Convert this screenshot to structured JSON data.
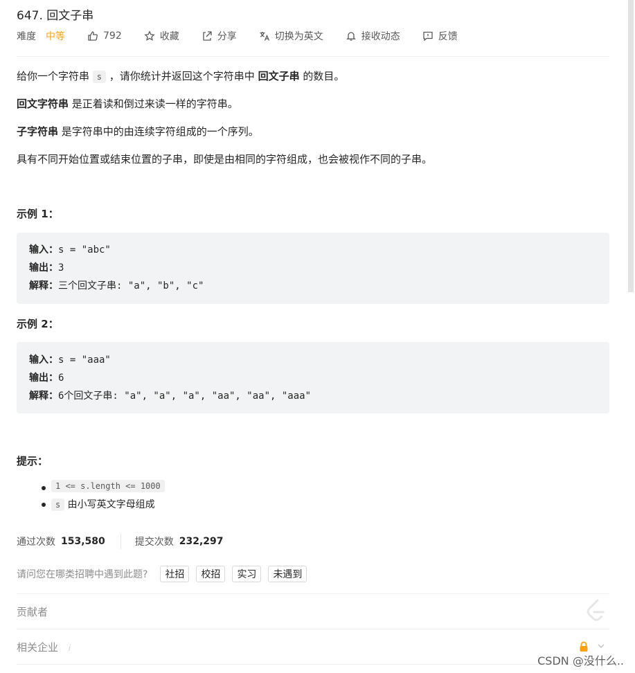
{
  "header": {
    "title": "647. 回文子串",
    "difficulty_label": "难度",
    "difficulty_value": "中等",
    "likes": "792",
    "favorite": "收藏",
    "share": "分享",
    "translate": "切换为英文",
    "notify": "接收动态",
    "feedback": "反馈"
  },
  "colors": {
    "difficulty": "#ffa116",
    "code_bg": "#f2f3f4"
  },
  "description": {
    "p1_before": "给你一个字符串 ",
    "p1_code": "s",
    "p1_mid": " ，请你统计并返回这个字符串中 ",
    "p1_bold": "回文子串",
    "p1_after": " 的数目。",
    "p2_bold": "回文字符串",
    "p2_rest": " 是正着读和倒过来读一样的字符串。",
    "p3_bold": "子字符串",
    "p3_rest": " 是字符串中的由连续字符组成的一个序列。",
    "p4": "具有不同开始位置或结束位置的子串，即使是由相同的字符组成，也会被视作不同的子串。"
  },
  "examples": [
    {
      "title": "示例 1：",
      "input_label": "输入：",
      "input": "s = \"abc\"",
      "output_label": "输出：",
      "output": "3",
      "explain_label": "解释：",
      "explain": "三个回文子串: \"a\", \"b\", \"c\""
    },
    {
      "title": "示例 2：",
      "input_label": "输入：",
      "input": "s = \"aaa\"",
      "output_label": "输出：",
      "output": "6",
      "explain_label": "解释：",
      "explain": "6个回文子串: \"a\", \"a\", \"a\", \"aa\", \"aa\", \"aaa\""
    }
  ],
  "tips": {
    "title": "提示：",
    "items": [
      {
        "code": "1 <= s.length <= 1000",
        "text": ""
      },
      {
        "code": "s",
        "text": " 由小写英文字母组成"
      }
    ]
  },
  "stats": {
    "accepted_label": "通过次数",
    "accepted": "153,580",
    "submitted_label": "提交次数",
    "submitted": "232,297"
  },
  "interview": {
    "question": "请问您在哪类招聘中遇到此题?",
    "options": [
      "社招",
      "校招",
      "实习",
      "未遇到"
    ]
  },
  "contributors": {
    "label": "贡献者"
  },
  "companies": {
    "label": "相关企业",
    "info": "i"
  },
  "watermark": "CSDN @没什么.."
}
